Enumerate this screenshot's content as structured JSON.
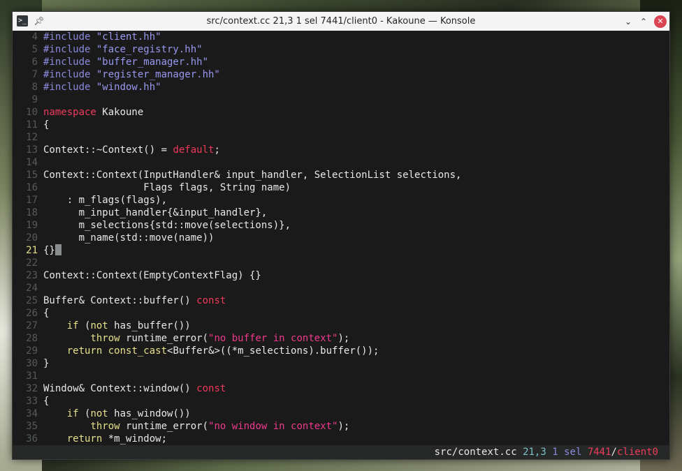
{
  "window": {
    "title": "src/context.cc 21,3 1 sel 7441/client0 - Kakoune — Konsole",
    "icons": {
      "app": "terminal-icon",
      "pin": "pin-icon",
      "minimize": "chevron-down-icon",
      "maximize": "chevron-up-icon",
      "close": "close-icon"
    }
  },
  "editor": {
    "current_line": 21,
    "lines": [
      {
        "n": "4",
        "segs": [
          {
            "t": "#include ",
            "c": "pp"
          },
          {
            "t": "\"client.hh\"",
            "c": "str"
          }
        ]
      },
      {
        "n": "5",
        "segs": [
          {
            "t": "#include ",
            "c": "pp"
          },
          {
            "t": "\"face_registry.hh\"",
            "c": "str"
          }
        ]
      },
      {
        "n": "6",
        "segs": [
          {
            "t": "#include ",
            "c": "pp"
          },
          {
            "t": "\"buffer_manager.hh\"",
            "c": "str"
          }
        ]
      },
      {
        "n": "7",
        "segs": [
          {
            "t": "#include ",
            "c": "pp"
          },
          {
            "t": "\"register_manager.hh\"",
            "c": "str"
          }
        ]
      },
      {
        "n": "8",
        "segs": [
          {
            "t": "#include ",
            "c": "pp"
          },
          {
            "t": "\"window.hh\"",
            "c": "str"
          }
        ]
      },
      {
        "n": "9",
        "segs": []
      },
      {
        "n": "10",
        "segs": [
          {
            "t": "namespace",
            "c": "kw"
          },
          {
            "t": " Kakoune",
            "c": ""
          }
        ]
      },
      {
        "n": "11",
        "segs": [
          {
            "t": "{",
            "c": ""
          }
        ]
      },
      {
        "n": "12",
        "segs": []
      },
      {
        "n": "13",
        "segs": [
          {
            "t": "Context::~Context() = ",
            "c": ""
          },
          {
            "t": "default",
            "c": "kw"
          },
          {
            "t": ";",
            "c": ""
          }
        ]
      },
      {
        "n": "14",
        "segs": []
      },
      {
        "n": "15",
        "segs": [
          {
            "t": "Context::Context(InputHandler& input_handler, SelectionList selections,",
            "c": ""
          }
        ]
      },
      {
        "n": "16",
        "segs": [
          {
            "t": "                 Flags flags, String name)",
            "c": ""
          }
        ]
      },
      {
        "n": "17",
        "segs": [
          {
            "t": "    : m_flags(flags),",
            "c": ""
          }
        ]
      },
      {
        "n": "18",
        "segs": [
          {
            "t": "      m_input_handler{&input_handler},",
            "c": ""
          }
        ]
      },
      {
        "n": "19",
        "segs": [
          {
            "t": "      m_selections{std::move(selections)},",
            "c": ""
          }
        ]
      },
      {
        "n": "20",
        "segs": [
          {
            "t": "      m_name(std::move(name))",
            "c": ""
          }
        ]
      },
      {
        "n": "21",
        "segs": [
          {
            "t": "{}",
            "c": ""
          }
        ],
        "cursor": true
      },
      {
        "n": "22",
        "segs": []
      },
      {
        "n": "23",
        "segs": [
          {
            "t": "Context::Context(EmptyContextFlag) {}",
            "c": ""
          }
        ]
      },
      {
        "n": "24",
        "segs": []
      },
      {
        "n": "25",
        "segs": [
          {
            "t": "Buffer& Context::buffer() ",
            "c": ""
          },
          {
            "t": "const",
            "c": "kw"
          }
        ]
      },
      {
        "n": "26",
        "segs": [
          {
            "t": "{",
            "c": ""
          }
        ]
      },
      {
        "n": "27",
        "segs": [
          {
            "t": "    ",
            "c": ""
          },
          {
            "t": "if",
            "c": "kw2"
          },
          {
            "t": " (",
            "c": ""
          },
          {
            "t": "not",
            "c": "kw2"
          },
          {
            "t": " has_buffer())",
            "c": ""
          }
        ]
      },
      {
        "n": "28",
        "segs": [
          {
            "t": "        ",
            "c": ""
          },
          {
            "t": "throw",
            "c": "kw2"
          },
          {
            "t": " runtime_error(",
            "c": ""
          },
          {
            "t": "\"no buffer in context\"",
            "c": "pstr"
          },
          {
            "t": ");",
            "c": ""
          }
        ]
      },
      {
        "n": "29",
        "segs": [
          {
            "t": "    ",
            "c": ""
          },
          {
            "t": "return",
            "c": "kw2"
          },
          {
            "t": " ",
            "c": ""
          },
          {
            "t": "const_cast",
            "c": "kw2"
          },
          {
            "t": "<Buffer&>((*m_selections).buffer());",
            "c": ""
          }
        ]
      },
      {
        "n": "30",
        "segs": [
          {
            "t": "}",
            "c": ""
          }
        ]
      },
      {
        "n": "31",
        "segs": []
      },
      {
        "n": "32",
        "segs": [
          {
            "t": "Window& Context::window() ",
            "c": ""
          },
          {
            "t": "const",
            "c": "kw"
          }
        ]
      },
      {
        "n": "33",
        "segs": [
          {
            "t": "{",
            "c": ""
          }
        ]
      },
      {
        "n": "34",
        "segs": [
          {
            "t": "    ",
            "c": ""
          },
          {
            "t": "if",
            "c": "kw2"
          },
          {
            "t": " (",
            "c": ""
          },
          {
            "t": "not",
            "c": "kw2"
          },
          {
            "t": " has_window())",
            "c": ""
          }
        ]
      },
      {
        "n": "35",
        "segs": [
          {
            "t": "        ",
            "c": ""
          },
          {
            "t": "throw",
            "c": "kw2"
          },
          {
            "t": " runtime_error(",
            "c": ""
          },
          {
            "t": "\"no window in context\"",
            "c": "pstr"
          },
          {
            "t": ");",
            "c": ""
          }
        ]
      },
      {
        "n": "36",
        "segs": [
          {
            "t": "    ",
            "c": ""
          },
          {
            "t": "return",
            "c": "kw2"
          },
          {
            "t": " *m_window;",
            "c": ""
          }
        ]
      }
    ]
  },
  "statusbar": {
    "file": "src/context.cc",
    "position": "21,3",
    "selection": "1 sel",
    "pid": "7441",
    "separator": "/",
    "client": "client0"
  }
}
